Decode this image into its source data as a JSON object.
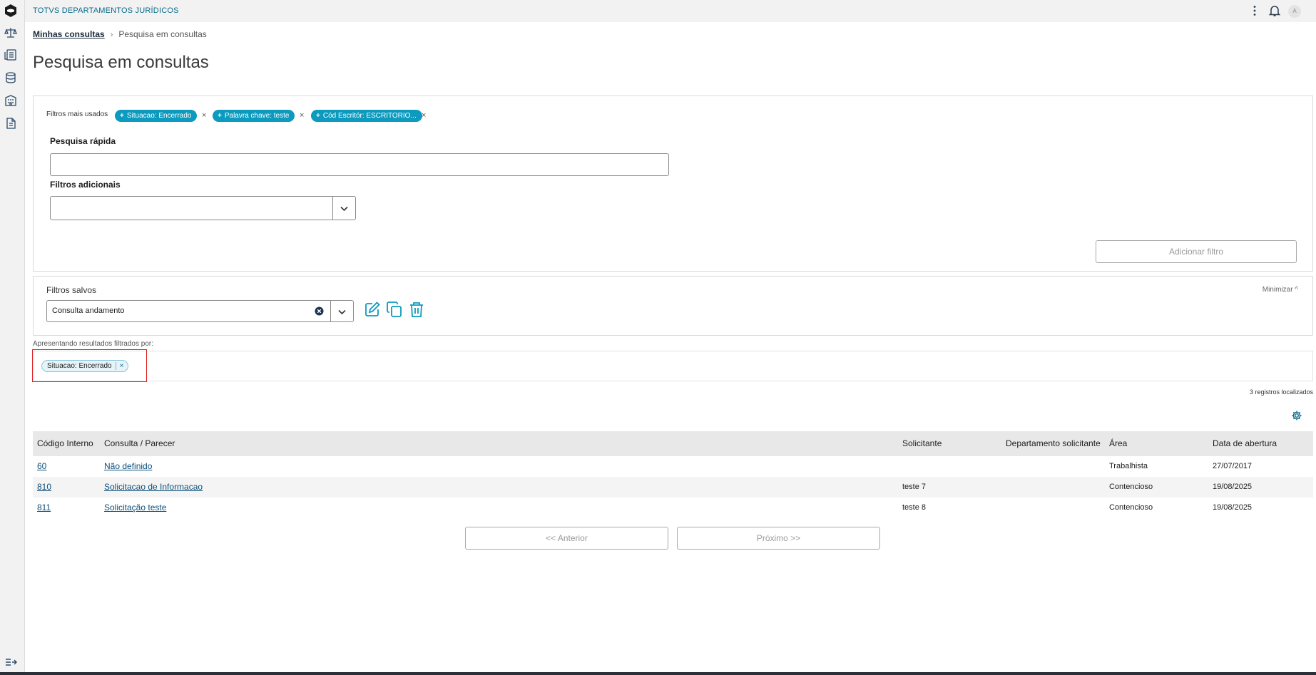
{
  "app": {
    "title": "TOTVS DEPARTAMENTOS JURÍDICOS",
    "avatar": "A"
  },
  "sidebar": {
    "items": [
      {
        "icon": "scale-icon"
      },
      {
        "icon": "dashboard-icon"
      },
      {
        "icon": "database-icon"
      },
      {
        "icon": "building-icon"
      },
      {
        "icon": "document-icon"
      }
    ],
    "collapse_icon": "expand-menu-icon"
  },
  "breadcrumb": {
    "parent": "Minhas consultas",
    "separator": "›",
    "current": "Pesquisa em consultas"
  },
  "page": {
    "title": "Pesquisa em consultas"
  },
  "favorite_filters": {
    "label": "Filtros mais usados",
    "chips": [
      {
        "plus": "+",
        "label": "Situacao: Encerrado"
      },
      {
        "plus": "+",
        "label": "Palavra chave: teste"
      },
      {
        "plus": "+",
        "label": "Cód Escritór: ESCRITORIO..."
      }
    ],
    "close_glyph": "×"
  },
  "quick_search": {
    "label": "Pesquisa rápida",
    "value": ""
  },
  "additional_filters": {
    "label": "Filtros adicionais",
    "value": ""
  },
  "add_filter_button": "Adicionar filtro",
  "saved_filters": {
    "title": "Filtros salvos",
    "minimize": "Minimizar ^",
    "selected": "Consulta andamento"
  },
  "results": {
    "label": "Apresentando resultados filtrados por:",
    "applied": {
      "label": "Situacao: Encerrado",
      "close": "×"
    },
    "count": "3 registros localizados"
  },
  "table": {
    "columns": [
      "Código Interno",
      "Consulta / Parecer",
      "Solicitante",
      "Departamento solicitante",
      "Área",
      "Data de abertura"
    ],
    "rows": [
      {
        "codigo": "60",
        "consulta": "Não definido",
        "solicitante": "",
        "departamento": "",
        "area": "Trabalhista",
        "data": "27/07/2017"
      },
      {
        "codigo": "810",
        "consulta": "Solicitacao de Informacao",
        "solicitante": "teste 7",
        "departamento": "",
        "area": "Contencioso",
        "data": "19/08/2025"
      },
      {
        "codigo": "811",
        "consulta": "Solicitação teste",
        "solicitante": "teste 8",
        "departamento": "",
        "area": "Contencioso",
        "data": "19/08/2025"
      }
    ]
  },
  "pagination": {
    "prev": "<< Anterior",
    "next": "Próximo >>"
  },
  "colors": {
    "accent": "#0c9abe",
    "link": "#0b4f7a",
    "highlight": "#e02020"
  }
}
